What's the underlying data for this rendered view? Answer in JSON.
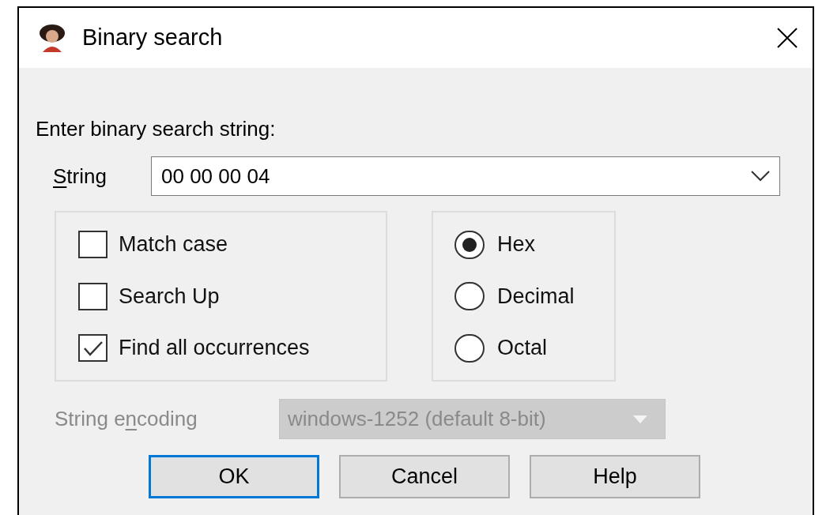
{
  "window": {
    "title": "Binary search"
  },
  "prompt": "Enter binary search string:",
  "string_field": {
    "label_parts": [
      {
        "text": "S",
        "underlined": true
      },
      {
        "text": "tring",
        "underlined": false
      }
    ],
    "value": "00 00 00 04"
  },
  "options": [
    {
      "label": "Match case",
      "checked": false
    },
    {
      "label": "Search Up",
      "checked": false
    },
    {
      "label": "Find all occurrences",
      "checked": true
    }
  ],
  "radix": [
    {
      "label": "Hex",
      "selected": true
    },
    {
      "label": "Decimal",
      "selected": false
    },
    {
      "label": "Octal",
      "selected": false
    }
  ],
  "encoding": {
    "label_parts": [
      {
        "text": "String e",
        "underlined": false
      },
      {
        "text": "n",
        "underlined": true
      },
      {
        "text": "coding",
        "underlined": false
      }
    ],
    "value": "windows-1252 (default 8-bit)",
    "disabled": true
  },
  "buttons": [
    {
      "label": "OK",
      "default": true
    },
    {
      "label": "Cancel",
      "default": false
    },
    {
      "label": "Help",
      "default": false
    }
  ]
}
